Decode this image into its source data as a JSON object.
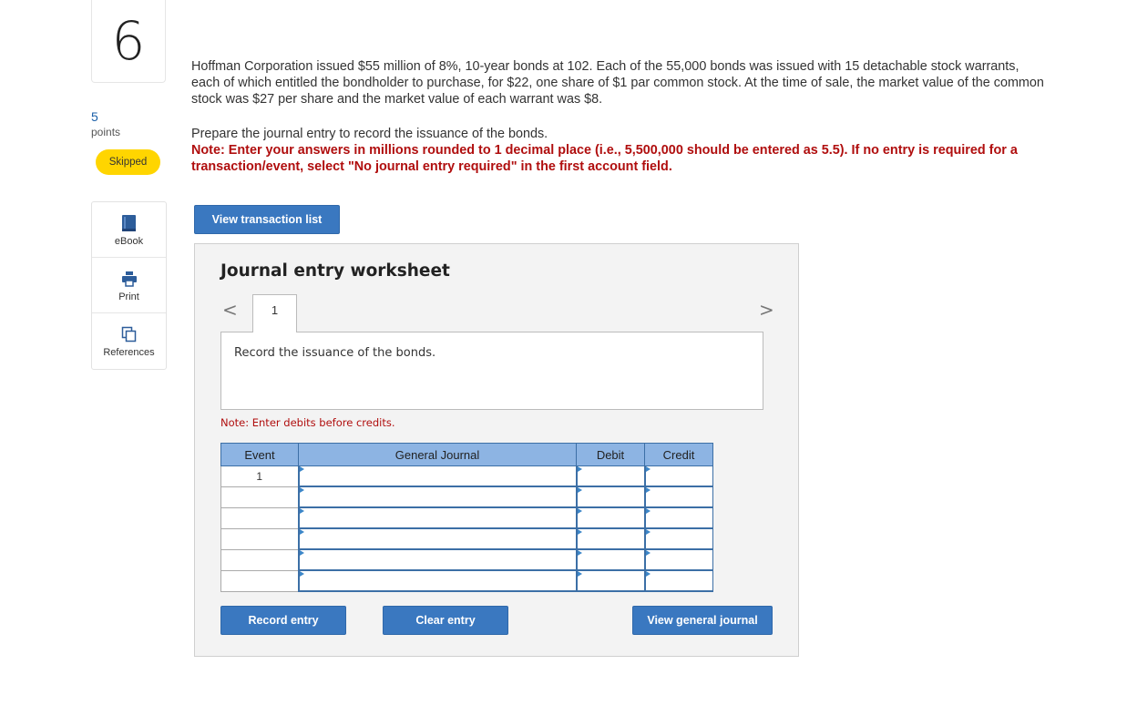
{
  "question": {
    "number": "6",
    "points_value": "5",
    "points_label": "points",
    "status": "Skipped",
    "text": "Hoffman Corporation issued $55 million of 8%, 10-year bonds at 102. Each of the 55,000 bonds was issued with 15 detachable stock warrants, each of which entitled the bondholder to purchase, for $22, one share of $1 par common stock. At the time of sale, the market value of the common stock was $27 per share and the market value of each warrant was $8.",
    "instruction": "Prepare the journal entry to record the issuance of the bonds.",
    "note": "Note: Enter your answers in millions rounded to 1 decimal place (i.e., 5,500,000 should be entered as 5.5). If no entry is required for a transaction/event, select \"No journal entry required\" in the first account field."
  },
  "tools": [
    {
      "label": "eBook",
      "icon": "book-icon"
    },
    {
      "label": "Print",
      "icon": "printer-icon"
    },
    {
      "label": "References",
      "icon": "copy-icon"
    }
  ],
  "buttons": {
    "view_transaction_list": "View transaction list",
    "record_entry": "Record entry",
    "clear_entry": "Clear entry",
    "view_general_journal": "View general journal"
  },
  "worksheet": {
    "title": "Journal entry worksheet",
    "nav_prev": "<",
    "nav_next": ">",
    "active_tab": "1",
    "description": "Record the issuance of the bonds.",
    "note_debits": "Note: Enter debits before credits.",
    "columns": [
      "Event",
      "General Journal",
      "Debit",
      "Credit"
    ],
    "rows": [
      {
        "event": "1",
        "account": "",
        "debit": "",
        "credit": ""
      },
      {
        "event": "",
        "account": "",
        "debit": "",
        "credit": ""
      },
      {
        "event": "",
        "account": "",
        "debit": "",
        "credit": ""
      },
      {
        "event": "",
        "account": "",
        "debit": "",
        "credit": ""
      },
      {
        "event": "",
        "account": "",
        "debit": "",
        "credit": ""
      },
      {
        "event": "",
        "account": "",
        "debit": "",
        "credit": ""
      }
    ]
  },
  "colors": {
    "accent_blue": "#3a78c0",
    "header_blue": "#8db4e3",
    "note_red": "#b00e0e",
    "status_yellow": "#ffd500"
  }
}
